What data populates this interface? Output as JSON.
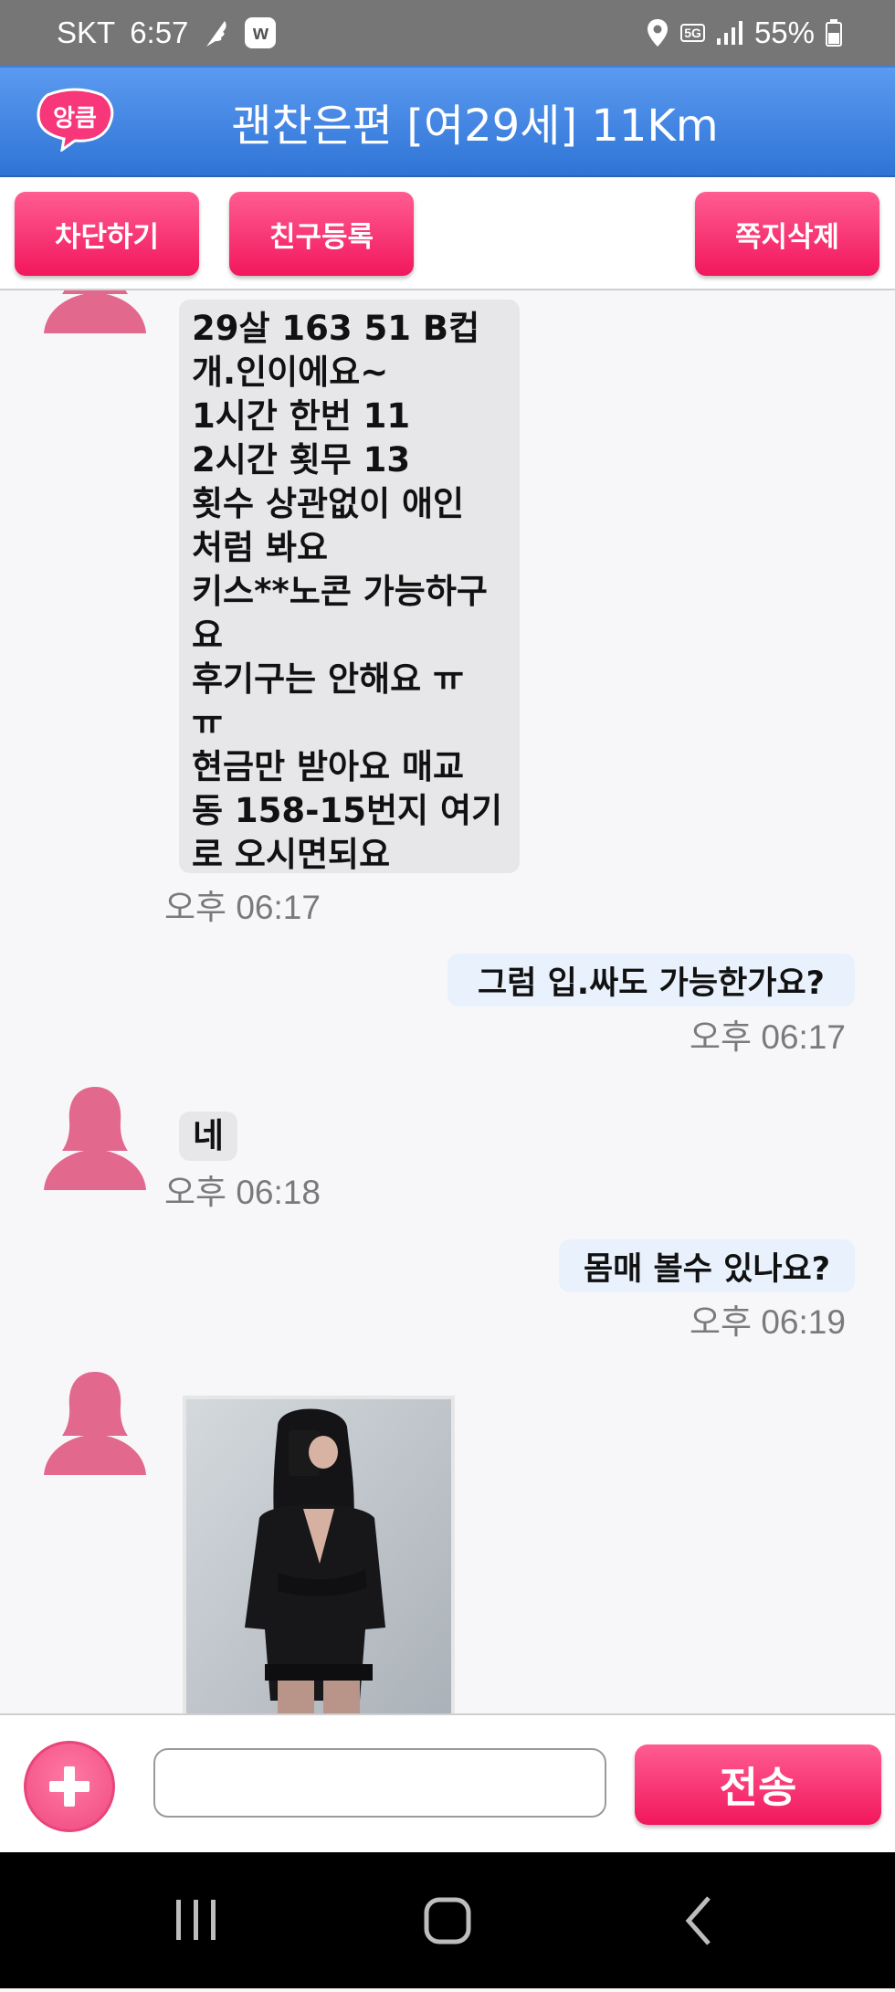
{
  "status_bar": {
    "carrier": "SKT",
    "time": "6:57",
    "network": "5G",
    "battery": "55%"
  },
  "header": {
    "logo_text": "앙큼",
    "title": "괜찬은편 [여29세] 11Km"
  },
  "actions": {
    "block_label": "차단하기",
    "friend_label": "친구등록",
    "delete_label": "쪽지삭제"
  },
  "messages": [
    {
      "from": "other",
      "lines": [
        "29살 163 51 B컵",
        "개.인이에요~",
        "1시간 한번 11",
        "2시간 횟무 13",
        "횟수 상관없이 애인",
        "처럼 봐요",
        "키스**노콘 가능하구",
        "요",
        "후기구는 안해요 ㅠ",
        "ㅠ",
        "현금만 받아요 매교",
        "동 158-15번지 여기",
        "로 오시면되요"
      ],
      "time": "오후 06:17"
    },
    {
      "from": "me",
      "text": "그럼 입.싸도 가능한가요?",
      "time": "오후 06:17"
    },
    {
      "from": "other",
      "text": "네",
      "time": "오후 06:18"
    },
    {
      "from": "me",
      "text": "몸매 볼수 있나요?",
      "time": "오후 06:19"
    },
    {
      "from": "other",
      "type": "photo"
    }
  ],
  "composer": {
    "input_placeholder": "",
    "send_label": "전송"
  },
  "colors": {
    "header_blue": "#3a80e0",
    "button_pink": "#f7266a",
    "avatar_pink": "#e2688e",
    "incoming_bubble": "#e7e7ea",
    "outgoing_bubble": "#e9f1fc"
  }
}
